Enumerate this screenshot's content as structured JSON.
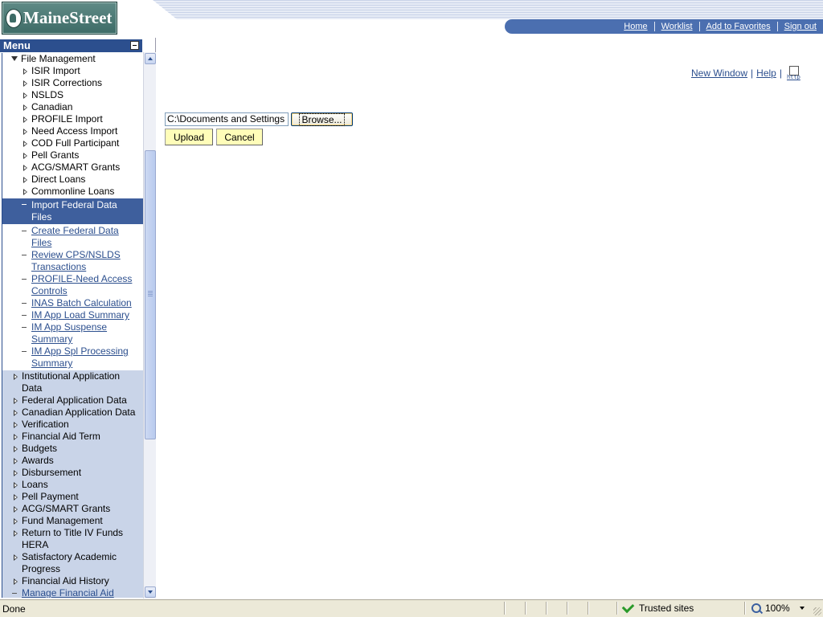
{
  "header": {
    "logo_text": "MaineStreet",
    "nav": [
      {
        "label": "Home"
      },
      {
        "label": "Worklist"
      },
      {
        "label": "Add to Favorites"
      },
      {
        "label": "Sign out"
      }
    ]
  },
  "menu": {
    "title": "Menu",
    "section_open": {
      "label": "File Management"
    },
    "file_mgmt_items": [
      {
        "label": "ISIR Import"
      },
      {
        "label": "ISIR Corrections"
      },
      {
        "label": "NSLDS"
      },
      {
        "label": "Canadian"
      },
      {
        "label": "PROFILE Import"
      },
      {
        "label": "Need Access Import"
      },
      {
        "label": "COD Full Participant"
      },
      {
        "label": "Pell Grants"
      },
      {
        "label": "ACG/SMART Grants"
      },
      {
        "label": "Direct Loans"
      },
      {
        "label": "Commonline Loans"
      }
    ],
    "selected_item": {
      "line1": "Import Federal Data",
      "line2": "Files"
    },
    "link_items": [
      {
        "line1": "Create Federal Data",
        "line2": "Files"
      },
      {
        "line1": "Review CPS/NSLDS",
        "line2": "Transactions"
      },
      {
        "line1": "PROFILE-Need Access",
        "line2": "Controls"
      },
      {
        "line1": "INAS Batch Calculation",
        "line2": ""
      },
      {
        "line1": "IM App Load Summary",
        "line2": ""
      },
      {
        "line1": "IM App Suspense",
        "line2": "Summary"
      },
      {
        "line1": "IM App Spl Processing",
        "line2": "Summary"
      }
    ],
    "other_sections": [
      {
        "line1": "Institutional Application",
        "line2": "Data"
      },
      {
        "line1": "Federal Application Data",
        "line2": ""
      },
      {
        "line1": "Canadian Application Data",
        "line2": ""
      },
      {
        "line1": "Verification",
        "line2": ""
      },
      {
        "line1": "Financial Aid Term",
        "line2": ""
      },
      {
        "line1": "Budgets",
        "line2": ""
      },
      {
        "line1": "Awards",
        "line2": ""
      },
      {
        "line1": "Disbursement",
        "line2": ""
      },
      {
        "line1": "Loans",
        "line2": ""
      },
      {
        "line1": "Pell Payment",
        "line2": ""
      },
      {
        "line1": "ACG/SMART Grants",
        "line2": ""
      },
      {
        "line1": "Fund Management",
        "line2": ""
      },
      {
        "line1": "Return to Title IV Funds",
        "line2": "HERA"
      },
      {
        "line1": "Satisfactory Academic",
        "line2": "Progress"
      },
      {
        "line1": "Financial Aid History",
        "line2": ""
      }
    ],
    "last_link": {
      "label": "Manage Financial Aid"
    }
  },
  "content": {
    "new_window": "New Window",
    "help": "Help",
    "file_path": "C:\\Documents and Settings",
    "browse_label": "Browse...",
    "upload_label": "Upload",
    "cancel_label": "Cancel"
  },
  "statusbar": {
    "status": "Done",
    "zone": "Trusted sites",
    "zoom": "100%"
  },
  "colors": {
    "menu_header": "#2c4f8e",
    "selected": "#3e5f9d",
    "link": "#2c4f8e",
    "button_bg": "#fffdb9"
  }
}
